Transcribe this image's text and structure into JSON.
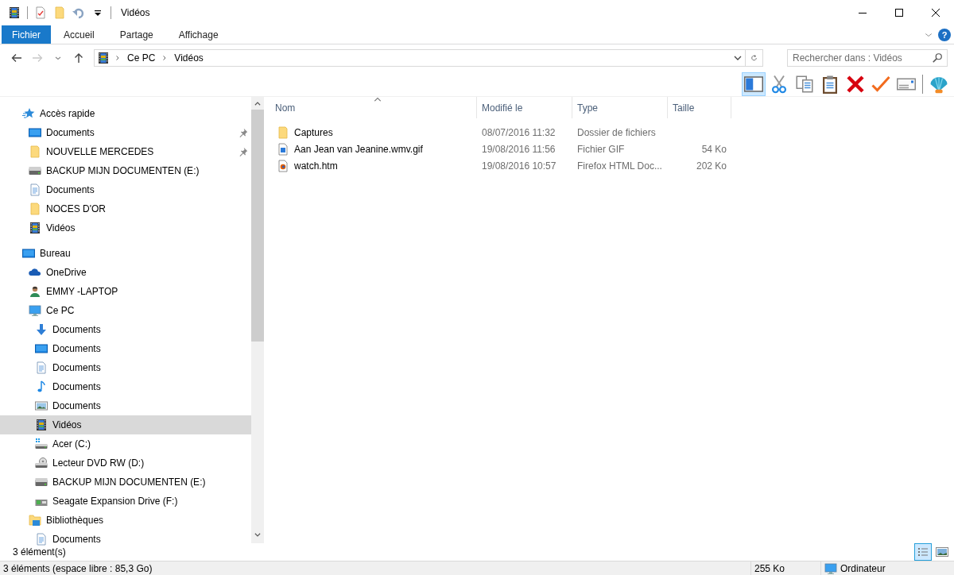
{
  "window": {
    "title": "Vidéos"
  },
  "quick_access": [
    {
      "kind": "film"
    },
    {
      "kind": "properties"
    },
    {
      "kind": "newfolder"
    },
    {
      "kind": "undo"
    },
    {
      "kind": "customize"
    }
  ],
  "ribbon_tabs": [
    {
      "label": "Fichier",
      "kind": "file"
    },
    {
      "label": "Accueil",
      "kind": "tab"
    },
    {
      "label": "Partage",
      "kind": "tab"
    },
    {
      "label": "Affichage",
      "kind": "tab"
    }
  ],
  "help": "?",
  "address": {
    "forward_disabled": true,
    "breadcrumb": [
      "Ce PC",
      "Vidéos"
    ]
  },
  "search": {
    "placeholder": "Rechercher dans : Vidéos"
  },
  "toolbar": {
    "preview_pane_on": true,
    "tools": [
      {
        "kind": "cut"
      },
      {
        "kind": "copy"
      },
      {
        "kind": "paste"
      },
      {
        "kind": "delete"
      },
      {
        "kind": "check"
      },
      {
        "kind": "mail"
      },
      {
        "kind": "shell"
      }
    ]
  },
  "sidebar": {
    "items": [
      {
        "label": "Accès rapide",
        "kind": "star",
        "selected": false,
        "children": [
          {
            "label": "Documents",
            "kind": "desktop",
            "selected": false,
            "pinned": true
          },
          {
            "label": "NOUVELLE MERCEDES",
            "kind": "folder",
            "selected": false,
            "pinned": true
          },
          {
            "label": "BACKUP MIJN DOCUMENTEN (E:)",
            "kind": "drive",
            "selected": false,
            "pinned": false
          },
          {
            "label": "Documents",
            "kind": "doc",
            "selected": false,
            "pinned": false
          },
          {
            "label": "NOCES D'OR",
            "kind": "folder",
            "selected": false,
            "pinned": false
          },
          {
            "label": "Vidéos",
            "kind": "film",
            "selected": false,
            "pinned": false
          }
        ]
      },
      {
        "label": "Bureau",
        "kind": "desktop",
        "selected": false,
        "children": [
          {
            "label": "OneDrive",
            "kind": "cloud",
            "selected": false
          },
          {
            "label": "EMMY -LAPTOP",
            "kind": "person",
            "selected": false
          },
          {
            "label": "Ce PC",
            "kind": "pc",
            "selected": false,
            "children": [
              {
                "label": "Documents",
                "kind": "download",
                "selected": false
              },
              {
                "label": "Documents",
                "kind": "desktop",
                "selected": false
              },
              {
                "label": "Documents",
                "kind": "doc",
                "selected": false
              },
              {
                "label": "Documents",
                "kind": "music",
                "selected": false
              },
              {
                "label": "Documents",
                "kind": "picture",
                "selected": false
              },
              {
                "label": "Vidéos",
                "kind": "film",
                "selected": true
              },
              {
                "label": "Acer (C:)",
                "kind": "windrive",
                "selected": false
              },
              {
                "label": "Lecteur DVD RW (D:)",
                "kind": "dvd",
                "selected": false
              },
              {
                "label": "BACKUP MIJN DOCUMENTEN (E:)",
                "kind": "drive",
                "selected": false
              },
              {
                "label": "Seagate Expansion Drive (F:)",
                "kind": "usb",
                "selected": false
              }
            ]
          },
          {
            "label": "Bibliothèques",
            "kind": "library",
            "selected": false,
            "children": [
              {
                "label": "Documents",
                "kind": "doc",
                "selected": false
              }
            ]
          }
        ]
      }
    ]
  },
  "table": {
    "columns": [
      {
        "label": "Nom",
        "sorted": true
      },
      {
        "label": "Modifié le",
        "sorted": false
      },
      {
        "label": "Type",
        "sorted": false
      },
      {
        "label": "Taille",
        "sorted": false
      }
    ],
    "rows": [
      {
        "kind": "folder",
        "name": "Captures",
        "modified": "08/07/2016 11:32",
        "type": "Dossier de fichiers"
      },
      {
        "kind": "gif",
        "name": "Aan Jean van Jeanine.wmv.gif",
        "modified": "19/08/2016 11:56",
        "type": "Fichier GIF",
        "size": "54 Ko"
      },
      {
        "kind": "firefox",
        "name": "watch.htm",
        "modified": "19/08/2016 10:57",
        "type": "Firefox HTML Doc...",
        "size": "202 Ko"
      }
    ]
  },
  "item_count": "3 élément(s)",
  "views": [
    {
      "kind": "details",
      "selected": true
    },
    {
      "kind": "large",
      "selected": false
    }
  ],
  "status_bar": {
    "free_space": "3 éléments (espace libre : 85,3 Go)",
    "size": "255 Ko",
    "location": "Ordinateur"
  }
}
